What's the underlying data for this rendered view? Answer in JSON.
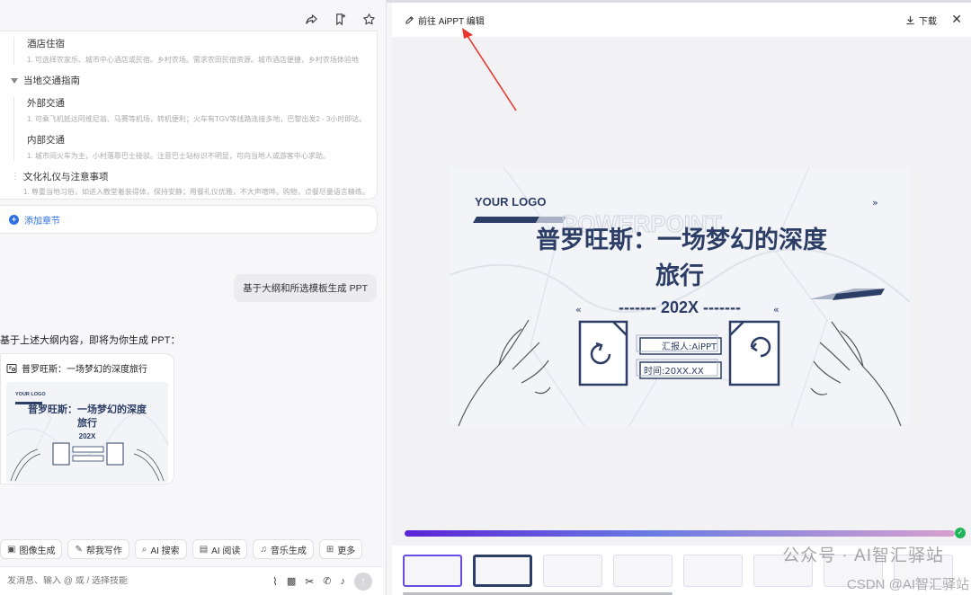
{
  "left": {
    "outline": {
      "items": [
        {
          "title": "酒店住宿",
          "desc": "1. 可选择农家乐、城市中心酒店或民宿。乡村农场。需求农田民宿资源。城市酒店便捷，乡村农场体验地"
        },
        {
          "section": "当地交通指南"
        },
        {
          "title": "外部交通",
          "desc": "1. 可乘飞机抵达阿维尼翁、马赛等机场，转机便利；火车有TGV等线路连接多地，巴黎出发2 - 3小时即达。"
        },
        {
          "title": "内部交通",
          "desc": "1. 城市间火车为主，小村落靠巴士接驳。注意巴士站标识不明显，可向当地人或游客中心求助。"
        },
        {
          "section": "文化礼仪与注意事项"
        },
        {
          "title": "",
          "desc": "1. 尊重当地习俗，如进入教堂着装得体，保持安静；用餐礼仪优雅，不大声喧哗。购物，点餐尽量语言精练。"
        }
      ],
      "add_section_label": "添加章节"
    },
    "user_message": "基于大纲和所选模板生成 PPT",
    "bot_message": "基于上述大纲内容，即将为你生成 PPT：",
    "ppt_card": {
      "title": "普罗旺斯：一场梦幻的深度旅行",
      "mini_logo": "YOUR LOGO",
      "mini_title_1": "普罗旺斯：一场梦幻的深度",
      "mini_title_2": "旅行",
      "mini_year": "202X"
    },
    "tools": [
      {
        "icon": "image-icon",
        "label": "图像生成"
      },
      {
        "icon": "pen-icon",
        "label": "帮我写作"
      },
      {
        "icon": "search-icon",
        "label": "AI 搜索"
      },
      {
        "icon": "read-icon",
        "label": "AI 阅读"
      },
      {
        "icon": "music-icon",
        "label": "音乐生成"
      },
      {
        "icon": "grid-icon",
        "label": "更多"
      }
    ],
    "input_placeholder": "发消息、输入 @ 或 / 选择技能"
  },
  "right": {
    "edit_link": "前往 AiPPT 编辑",
    "download": "下载",
    "slide": {
      "logo": "YOUR LOGO",
      "bg_word": "POWERPOINT",
      "title_line1": "普罗旺斯：一场梦幻的深度",
      "title_line2": "旅行",
      "year": "------- 202X -------",
      "reporter": "汇报人:AiPPT",
      "time": "时间:20XX.XX"
    },
    "progress_percent": 100,
    "watermark": "公众号 · AI智汇驿站",
    "watermark2": "CSDN @AI智汇驿站"
  },
  "colors": {
    "accent": "#2f6fe4",
    "slide_navy": "#2c3e66",
    "progress_start": "#5b24d6",
    "progress_end": "#d7a0cf"
  }
}
